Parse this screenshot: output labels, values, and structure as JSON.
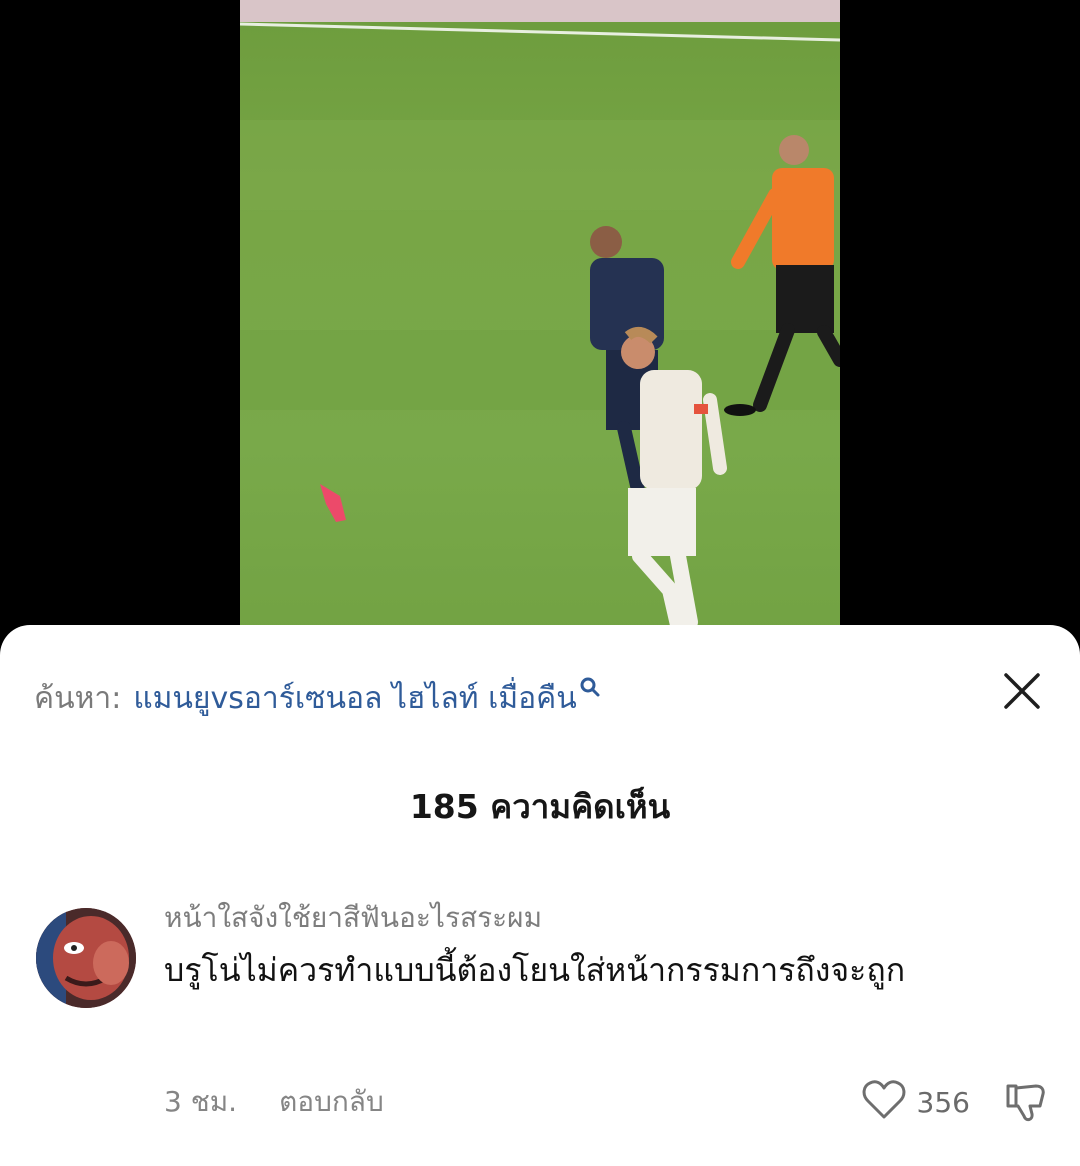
{
  "search": {
    "label": "ค้นหา:",
    "term": "แมนยูvsอาร์เซนอล ไฮไลท์ เมื่อคืน"
  },
  "comments_header": {
    "count_text": "185 ความคิดเห็น"
  },
  "comment": {
    "username": "หน้าใสจังใช้ยาสีฟันอะไรสระผม",
    "text": "บรูโน่ไม่ควรทำแบบนี้ต้องโยนใส่หน้ากรรมการถึงจะถูก",
    "time": "3 ชม.",
    "reply_label": "ตอบกลับ",
    "like_count": "356"
  },
  "icons": {
    "search": "search-icon",
    "close": "close-icon",
    "like": "heart-icon",
    "dislike": "thumbs-down-icon"
  },
  "colors": {
    "search_term": "#2f5b99",
    "pitch_green": "#78a646",
    "referee_shirt": "#f07a2a"
  }
}
